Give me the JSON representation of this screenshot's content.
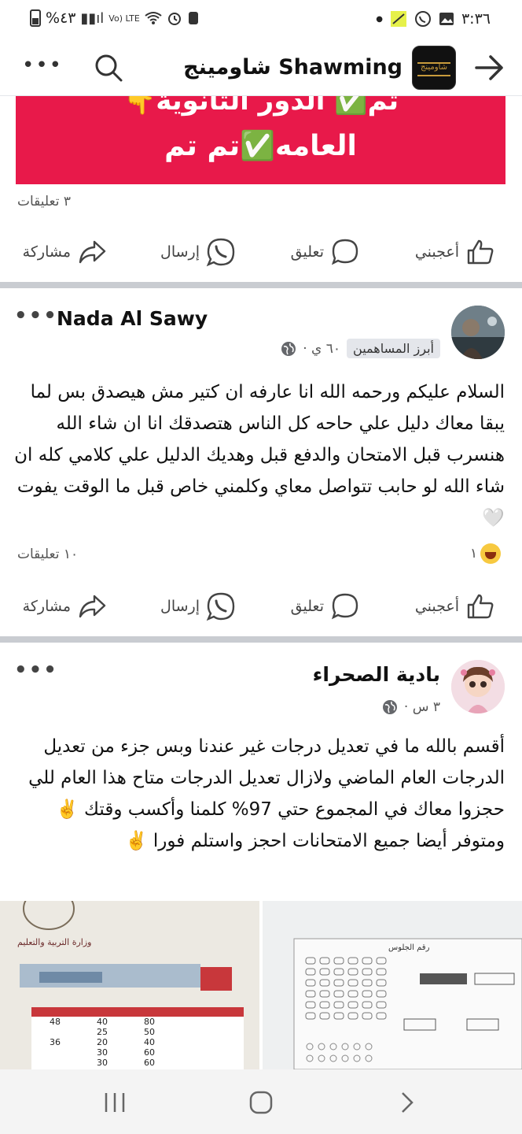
{
  "status_bar": {
    "battery_percent": "%٤٣",
    "network_label": "Vo) LTE",
    "time": "٣:٣٦"
  },
  "top_bar": {
    "page_name": "شاومينج Shawming",
    "avatar_text": "شاومينج"
  },
  "post1": {
    "banner_line1": "👇تم✅ الدور الثانوية",
    "banner_line2": "العامه✅تم تم",
    "comments": "٣ تعليقات"
  },
  "actions": {
    "like": "أعجبني",
    "comment": "تعليق",
    "send": "إرسال",
    "share": "مشاركة"
  },
  "post2": {
    "author": "Nada Al Sawy",
    "badge": "أبرز المساهمين",
    "time": "٦٠ ي ·",
    "text": "السلام عليكم ورحمه الله انا عارفه ان كتير مش هيصدق بس لما يبقا معاك دليل علي حاحه كل الناس هتصدقك انا ان شاء الله هنسرب قبل الامتحان والدفع قبل وهديك الدليل علي كلامي كله ان شاء الله لو حابب تتواصل معاي وكلمني خاص قبل ما الوقت يفوت 🤍",
    "reactions_count": "١",
    "comments": "١٠ تعليقات"
  },
  "post3": {
    "author": "بادية الصحراء",
    "time": "٣ س ·",
    "text": "أقسم بالله ما في تعديل درجات غير عندنا وبس جزء من تعديل الدرجات العام الماضي ولازال تعديل الدرجات متاح هذا العام للي حجزوا معاك في المجموع حتي 97% كلمنا وأكسب وقتك ✌️ ومتوفر أيضا جميع الامتحانات احجز واستلم فورا ✌️",
    "photo_left": {
      "header": "وزارة التربية والتعليم",
      "scores": [
        [
          "48",
          "40",
          "80"
        ],
        [
          "",
          "25",
          "50"
        ],
        [
          "36",
          "20",
          "40"
        ],
        [
          "",
          "30",
          "60"
        ],
        [
          "",
          "30",
          "60"
        ]
      ]
    },
    "photo_right": {
      "header": "رقم الجلوس"
    }
  },
  "colors": {
    "banner_red": "#e8194a",
    "check_green": "#2bb24c",
    "divider_gray": "#c9ccd1"
  }
}
